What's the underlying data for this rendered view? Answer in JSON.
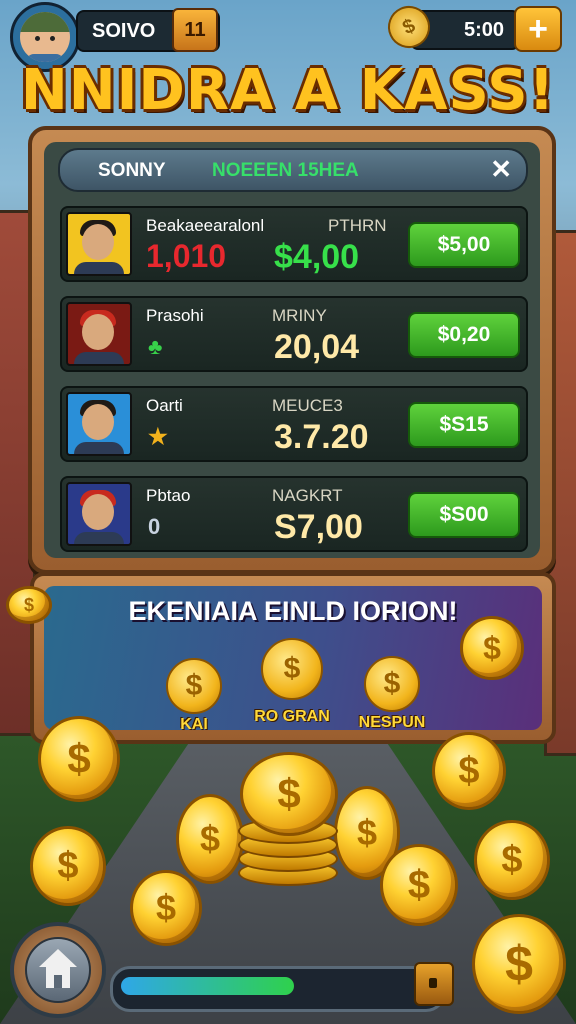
{
  "hud": {
    "player_name": "SOIVO",
    "level_badge": "11",
    "coin_amount": "5:00",
    "coin_symbol": "$",
    "plus_label": "+"
  },
  "title": "NNIDRA A KASS!",
  "panel": {
    "header_left": "SONNY",
    "header_mid": "NOEEEN 15HEA",
    "close_label": "✕",
    "rows": [
      {
        "name": "Beakaeearalonl",
        "sub": "PTHRN",
        "left_text": "1,010",
        "left_color": "#e8282e",
        "value": "$4,00",
        "value_color": "#37e04a",
        "button": "$5,00",
        "hair_color": "#1f1a16",
        "bg_color": "#f2c420"
      },
      {
        "name": "Prasohi",
        "sub": "MRINY",
        "left_text": "♣",
        "left_color": "#37d04a",
        "value": "20,04",
        "value_color": "#ffe9a8",
        "button": "$0,20",
        "hair_color": "#c82a1e",
        "bg_color": "#7a1a14"
      },
      {
        "name": "Oarti",
        "sub": "MEUCE3",
        "left_text": "★",
        "left_color": "#f2b21c",
        "value": "3.7.20",
        "value_color": "#ffe9a8",
        "button": "$S15",
        "hair_color": "#1f1a16",
        "bg_color": "#2a8fd8"
      },
      {
        "name": "Pbtao",
        "sub": "NAGKRT",
        "left_text": "0",
        "left_color": "#c8d2e0",
        "value": "S7,00",
        "value_color": "#ffe9a8",
        "button": "$S00",
        "hair_color": "#c82a1e",
        "bg_color": "#2a3a8a"
      }
    ]
  },
  "bonus": {
    "title": "EKENIAIA EINLD IORION!",
    "coin_symbol": "$",
    "items": [
      {
        "label": "KAI"
      },
      {
        "label": "RO GRAN"
      },
      {
        "label": "NESPUN"
      }
    ]
  },
  "footer": {
    "progress_fraction": 0.55,
    "home_icon": "home-icon",
    "chest_icon": "treasure-chest-icon"
  },
  "colors": {
    "title": "#ffc21f",
    "button_green": "#4bbf2e",
    "panel_wood": "#b47843"
  }
}
